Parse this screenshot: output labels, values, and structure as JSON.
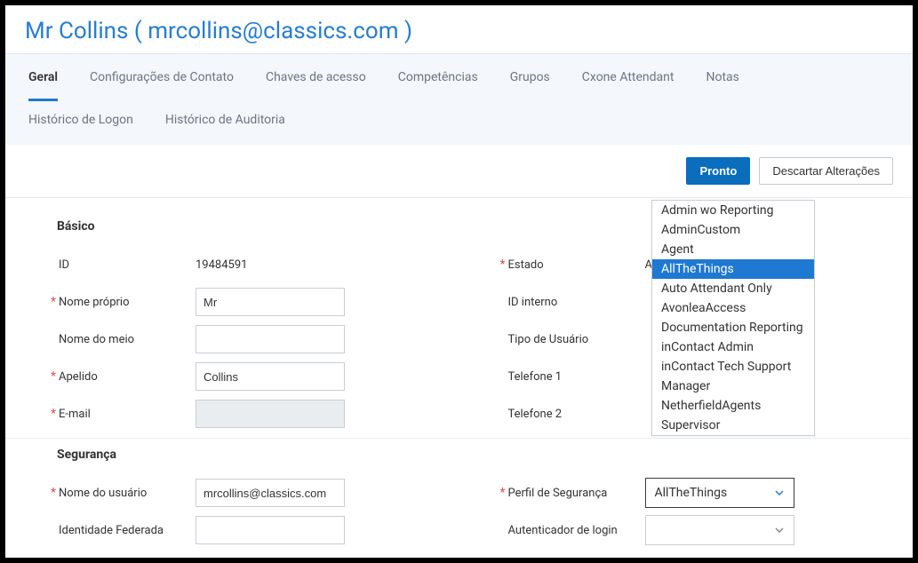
{
  "title": "Mr Collins ( mrcollins@classics.com )",
  "tabs_row1": [
    {
      "label": "Geral",
      "active": true
    },
    {
      "label": "Configurações de Contato",
      "active": false
    },
    {
      "label": "Chaves de acesso",
      "active": false
    },
    {
      "label": "Competências",
      "active": false
    },
    {
      "label": "Grupos",
      "active": false
    },
    {
      "label": "Cxone Attendant",
      "active": false
    },
    {
      "label": "Notas",
      "active": false
    }
  ],
  "tabs_row2": [
    {
      "label": "Histórico de Logon"
    },
    {
      "label": "Histórico de Auditoria"
    }
  ],
  "actions": {
    "done": "Pronto",
    "discard": "Descartar Alterações"
  },
  "sections": {
    "basic": "Básico",
    "security": "Segurança"
  },
  "fields": {
    "id_label": "ID",
    "id_value": "19484591",
    "first_name_label": "Nome próprio",
    "first_name_value": "Mr",
    "middle_name_label": "Nome do meio",
    "middle_name_value": "",
    "last_name_label": "Apelido",
    "last_name_value": "Collins",
    "email_label": "E-mail",
    "email_value": "",
    "status_label": "Estado",
    "status_value": "Activo",
    "internal_id_label": "ID interno",
    "internal_id_value": "",
    "user_type_label": "Tipo de Usuário",
    "user_type_value": "",
    "phone1_label": "Telefone 1",
    "phone1_value": "",
    "phone2_label": "Telefone 2",
    "phone2_value": "",
    "username_label": "Nome do usuário",
    "username_value": "mrcollins@classics.com",
    "federated_label": "Identidade Federada",
    "federated_value": "",
    "sec_profile_label": "Perfil de Segurança",
    "sec_profile_value": "AllTheThings",
    "login_auth_label": "Autenticador de login",
    "login_auth_value": ""
  },
  "dropdown": {
    "options": [
      "Admin wo Reporting",
      "AdminCustom",
      "Agent",
      "AllTheThings",
      "Auto Attendant Only",
      "AvonleaAccess",
      "Documentation Reporting",
      "inContact Admin",
      "inContact Tech Support",
      "Manager",
      "NetherfieldAgents",
      "Supervisor"
    ],
    "selected": "AllTheThings"
  }
}
